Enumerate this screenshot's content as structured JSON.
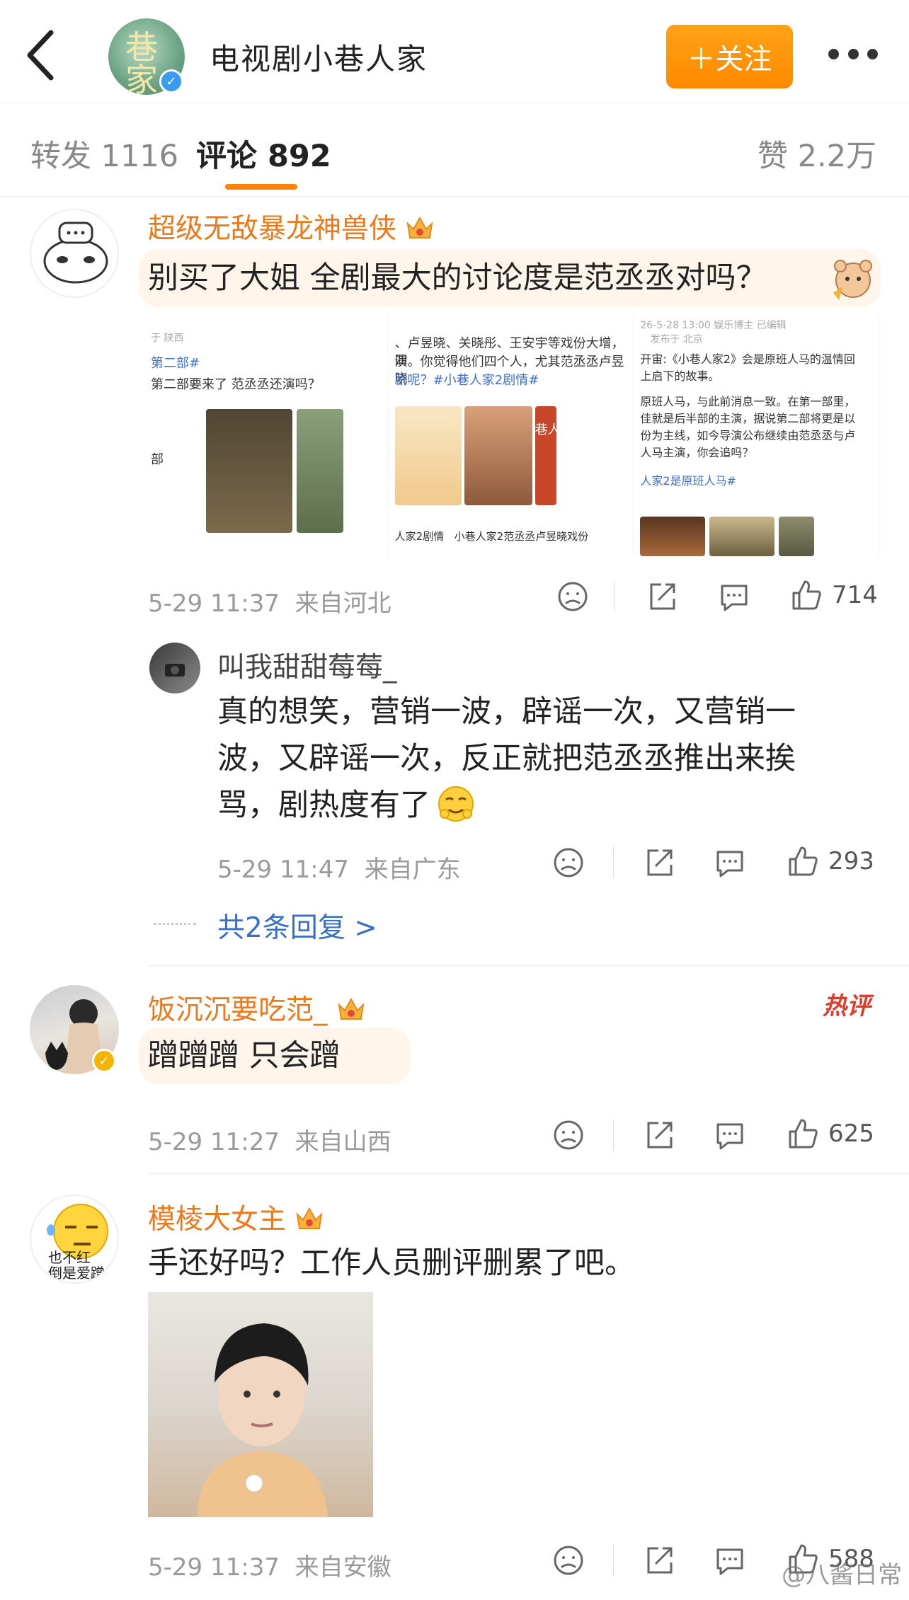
{
  "header": {
    "account_name": "电视剧小巷人家",
    "follow_label": "＋关注"
  },
  "tabs": {
    "repost": "转发 1116",
    "comments": "评论 892",
    "likes": "赞 2.2万"
  },
  "comments": [
    {
      "user": "超级无敌暴龙神兽侠",
      "text": "别买了大姐 全剧最大的讨论度是范丞丞对吗？",
      "time": "5-29 11:37",
      "location": "来自河北",
      "likes": "714",
      "images": {
        "p1_line1": "第二部#",
        "p1_line2": "第二部要来了  范丞丞还演吗？",
        "p1_from": "于 陕西",
        "p1_side": "部",
        "p2_line1": "、卢昱晓、关晓彤、王安宇等戏份大增，四",
        "p2_line2": "演。你觉得他们四个人，尤其范丞丞卢昱晓",
        "p2_line3": "剧呢？#小巷人家2剧情#",
        "p2_search1": "人家2剧情",
        "p2_search2": "小巷人家2范丞丞卢昱晓戏份",
        "p2_poster": "巷人家",
        "p3_meta": "26-5-28 13:00  娱乐博主 已编辑",
        "p3_from": "发布于 北京",
        "p3_line1": "开宙:《小巷人家2》会是原班人马的温情回",
        "p3_line2": "上启下的故事。",
        "p3_line3": "原班人马，与此前消息一致。在第一部里，",
        "p3_line4": "佳就是后半部的主演，据说第二部将更是以",
        "p3_line5": "份为主线，如今导演公布继续由范丞丞与卢",
        "p3_line6": "人马主演，你会追吗？",
        "p3_tag": "人家2是原班人马#"
      },
      "reply": {
        "user": "叫我甜甜莓莓_",
        "text_line1": "真的想笑，营销一波，辟谣一次，又营销一",
        "text_line2": "波，又辟谣一次，反正就把范丞丞推出来挨",
        "text_line3": "骂，剧热度有了",
        "time": "5-29 11:47",
        "location": "来自广东",
        "likes": "293"
      },
      "more_replies": "共2条回复 >"
    },
    {
      "user": "饭沉沉要吃范_",
      "text": "蹭蹭蹭 只会蹭",
      "hot_badge": "热评",
      "time": "5-29 11:27",
      "location": "来自山西",
      "likes": "625"
    },
    {
      "user": "模棱大女主",
      "text": "手还好吗？工作人员删评删累了吧。",
      "avatar_text1": "也不红",
      "avatar_text2": "倒是爱蹭",
      "time": "5-29 11:37",
      "location": "来自安徽",
      "likes": "588"
    }
  ],
  "watermark": "@八酱日常",
  "colors": {
    "accent": "#ff8200",
    "username": "#ea7a1c",
    "link": "#3a6fc6",
    "hot": "#e03c2c"
  }
}
